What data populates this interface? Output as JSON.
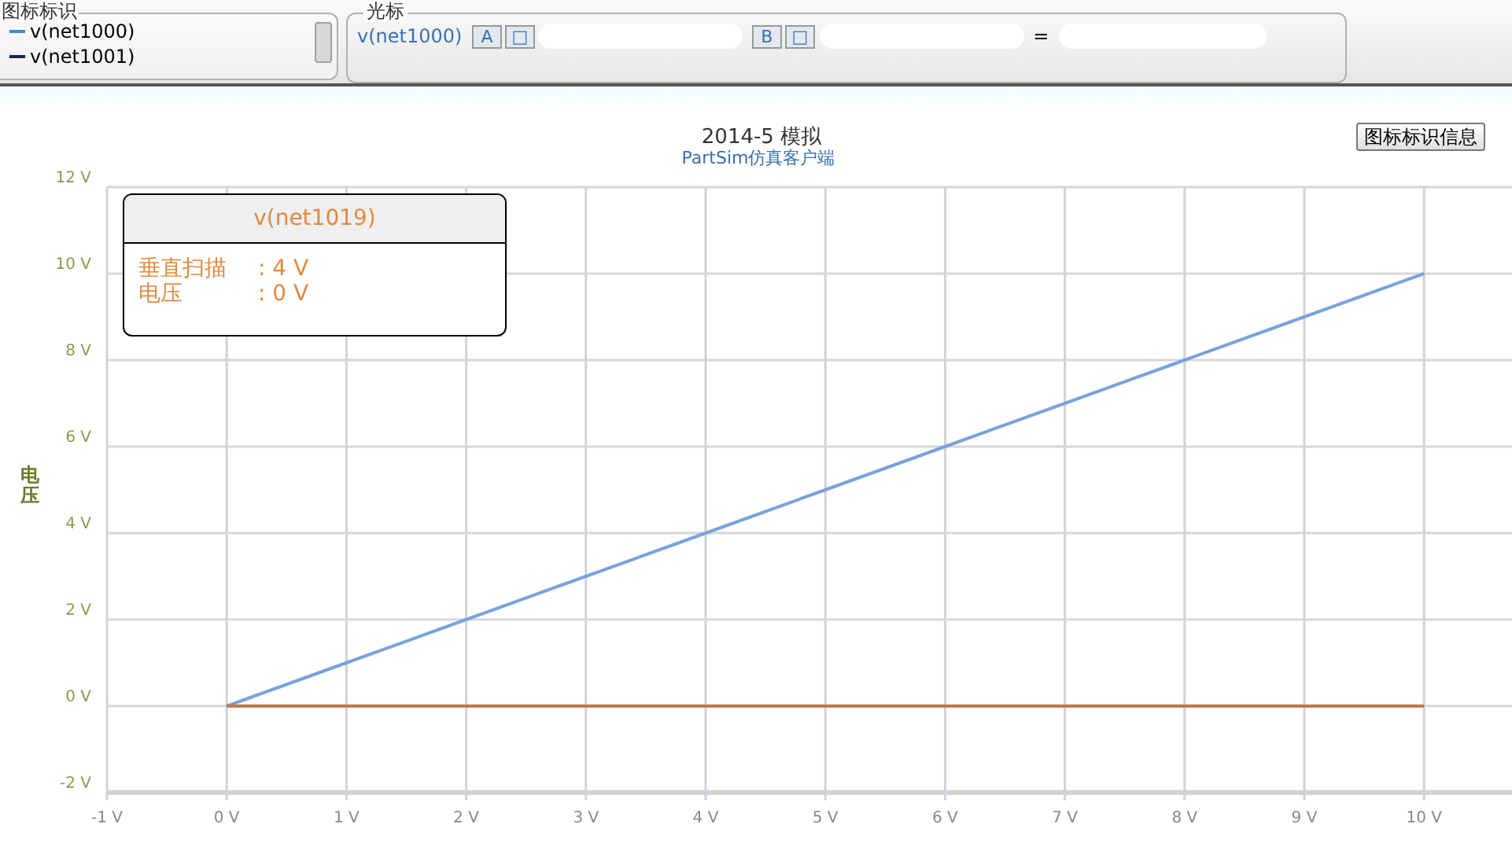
{
  "legend_panel": {
    "title": "图标标识",
    "items": [
      {
        "label": "v(net1000)",
        "color": "#4a86c8"
      },
      {
        "label": "v(net1001)",
        "color": "#1a2a4a"
      }
    ]
  },
  "cursor_panel": {
    "title": "光标",
    "signal": "v(net1000)",
    "button_a": "A",
    "button_a_square": "□",
    "button_b": "B",
    "button_b_square": "□",
    "equals": "="
  },
  "chart": {
    "title": "2014-5 模拟",
    "subtitle": "PartSim仿真客户端",
    "legend_info_button": "图标标识信息",
    "tooltip": {
      "title": "v(net1019)",
      "rows": [
        {
          "label": "垂直扫描",
          "value": ": 4 V"
        },
        {
          "label": "电压",
          "value": ": 0 V"
        }
      ]
    },
    "chart_data": {
      "type": "line",
      "ylabel": "电压",
      "x": [
        0,
        1,
        2,
        3,
        4,
        5,
        6,
        7,
        8,
        9,
        10
      ],
      "series": [
        {
          "color": "#7aa2dc",
          "values": [
            0,
            1,
            2,
            3,
            4,
            5,
            6,
            7,
            8,
            9,
            10
          ]
        },
        {
          "color": "#c0784a",
          "values": [
            0,
            0,
            0,
            0,
            0,
            0,
            0,
            0,
            0,
            0,
            0
          ]
        }
      ],
      "grid": true,
      "xlim": [
        -1,
        11
      ],
      "ylim": [
        -2,
        12
      ],
      "xticks": [
        {
          "value": -1,
          "label": "-1 V"
        },
        {
          "value": 0,
          "label": "0 V"
        },
        {
          "value": 1,
          "label": "1 V"
        },
        {
          "value": 2,
          "label": "2 V"
        },
        {
          "value": 3,
          "label": "3 V"
        },
        {
          "value": 4,
          "label": "4 V"
        },
        {
          "value": 5,
          "label": "5 V"
        },
        {
          "value": 6,
          "label": "6 V"
        },
        {
          "value": 7,
          "label": "7 V"
        },
        {
          "value": 8,
          "label": "8 V"
        },
        {
          "value": 9,
          "label": "9 V"
        },
        {
          "value": 10,
          "label": "10 V"
        }
      ],
      "yticks": [
        {
          "value": -2,
          "label": "-2 V"
        },
        {
          "value": 0,
          "label": "0 V"
        },
        {
          "value": 2,
          "label": "2 V"
        },
        {
          "value": 4,
          "label": "4 V"
        },
        {
          "value": 6,
          "label": "6 V"
        },
        {
          "value": 8,
          "label": "8 V"
        },
        {
          "value": 10,
          "label": "10 V"
        },
        {
          "value": 12,
          "label": "12 V"
        }
      ]
    }
  }
}
